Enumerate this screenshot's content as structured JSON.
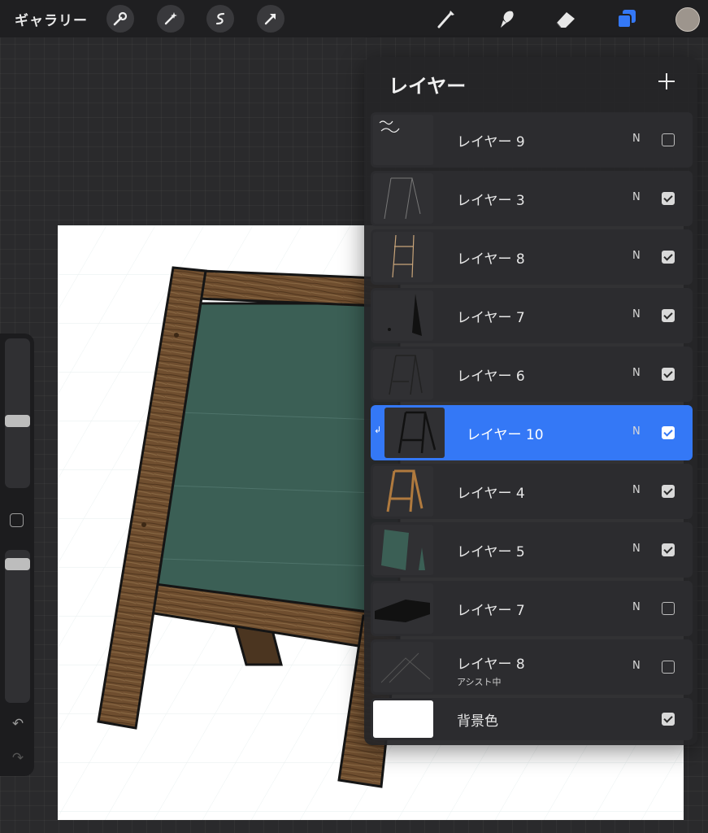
{
  "topbar": {
    "gallery_label": "ギャラリー",
    "left_tools": [
      "wrench-icon",
      "magic-wand-icon",
      "selection-icon",
      "transform-arrow-icon"
    ],
    "right_tools": [
      "brush-icon",
      "smudge-icon",
      "eraser-icon",
      "layers-icon"
    ],
    "active_tool": "layers-icon",
    "current_color": "#9d958d"
  },
  "layers_panel": {
    "title": "レイヤー",
    "layers": [
      {
        "name": "レイヤー 9",
        "blend": "N",
        "visible": false,
        "selected": false,
        "sub": ""
      },
      {
        "name": "レイヤー 3",
        "blend": "N",
        "visible": true,
        "selected": false,
        "sub": ""
      },
      {
        "name": "レイヤー 8",
        "blend": "N",
        "visible": true,
        "selected": false,
        "sub": ""
      },
      {
        "name": "レイヤー 7",
        "blend": "N",
        "visible": true,
        "selected": false,
        "sub": ""
      },
      {
        "name": "レイヤー 6",
        "blend": "N",
        "visible": true,
        "selected": false,
        "sub": ""
      },
      {
        "name": "レイヤー 10",
        "blend": "N",
        "visible": true,
        "selected": true,
        "sub": ""
      },
      {
        "name": "レイヤー 4",
        "blend": "N",
        "visible": true,
        "selected": false,
        "sub": ""
      },
      {
        "name": "レイヤー 5",
        "blend": "N",
        "visible": true,
        "selected": false,
        "sub": ""
      },
      {
        "name": "レイヤー 7",
        "blend": "N",
        "visible": false,
        "selected": false,
        "sub": ""
      },
      {
        "name": "レイヤー 8",
        "blend": "N",
        "visible": false,
        "selected": false,
        "sub": "アシスト中"
      }
    ],
    "background": {
      "name": "背景色",
      "visible": true,
      "color": "#ffffff"
    }
  },
  "sidebar": {
    "brush_size_level": 0.45,
    "opacity_level": 0.95
  },
  "colors": {
    "accent": "#3478f6",
    "chalkboard": "#3b5f55",
    "wood": "#6b4a2b"
  }
}
